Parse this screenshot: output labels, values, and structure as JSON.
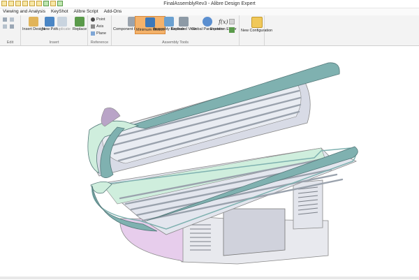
{
  "window": {
    "title": "FinalAssemblyRev3 - Alibre Design Expert"
  },
  "qat_icons": [
    "save-icon",
    "open-icon",
    "new-icon",
    "print-icon",
    "undo-icon",
    "redo-icon",
    "tool-icon",
    "tool-icon",
    "tool-icon"
  ],
  "menu": [
    "Viewing and Analysis",
    "KeyShot",
    "Alibre Script",
    "Add-Ons"
  ],
  "ribbon": {
    "groups": {
      "edit": "Edit",
      "insert": "Insert",
      "reference": "Reference",
      "assembly_tools": "Assembly Tools"
    },
    "insert_design": "Insert Design",
    "new_part": "New Part",
    "duplicate": "Duplicate",
    "replace": "Replace",
    "point": "Point",
    "axis": "Axis",
    "plane": "Plane",
    "component_placement": "Component Placement",
    "minimum_motion": "Minimum Motion",
    "assembly_boolean": "Assembly Boolean",
    "exploded_view": "Exploded View",
    "global_parameters": "Global Parameters",
    "equation_editor": "Equation Editor",
    "new_configuration": "New Configuration",
    "equation_symbol": "f(x)"
  },
  "colors": {
    "ribbon_bg": "#f3f3f3",
    "active_tool": "#f4b26a",
    "model_teal": "#7fb1b0",
    "model_mint": "#cfeedd",
    "model_base_pink": "#e7cdec",
    "model_frame": "#e8e9ee"
  }
}
